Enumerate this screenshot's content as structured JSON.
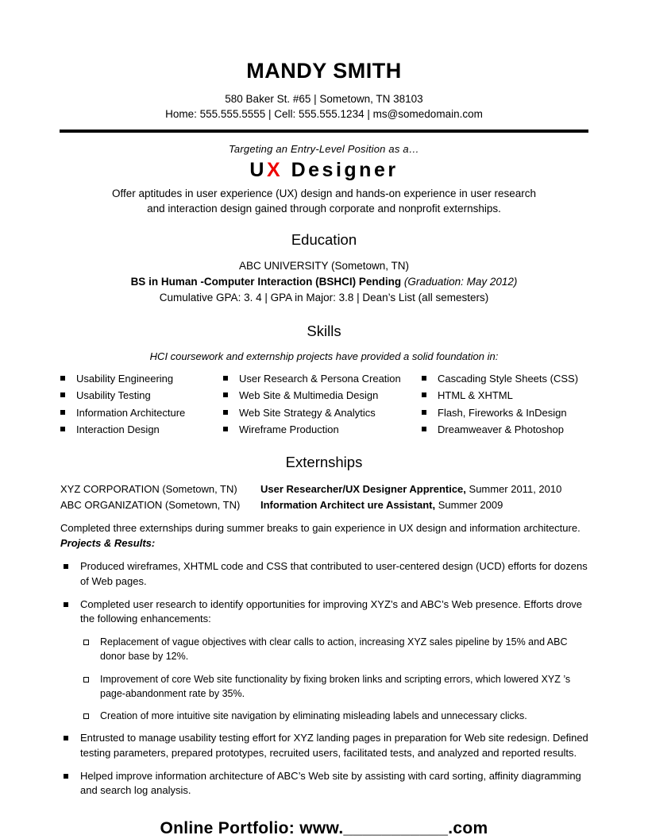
{
  "header": {
    "name": "MANDY SMITH",
    "address": "580 Baker St. #65 | Sometown, TN 38103",
    "contact": "Home:  555.555.5555 | Cell:  555.555.1234 | ms@somedomain.com"
  },
  "objective": {
    "tagline": "Targeting an Entry-Level Position as a…",
    "title_pre": "U",
    "title_accent": "X",
    "title_post": " Designer",
    "accent_color": "#ee0000",
    "summary_line1": "Offer  aptitudes in user experience (UX)  design  and hands-on experience in user research",
    "summary_line2": "and interaction design gained through  corporate and nonprofit  externships."
  },
  "sections": {
    "education_heading": "Education",
    "skills_heading": "Skills",
    "externships_heading": "Externships"
  },
  "education": {
    "school": "ABC UNIVERSITY (Sometown, TN)",
    "degree": "BS in Human -Computer Interaction  (BSHCI) Pending",
    "graduation": "(Graduation: May 2012)",
    "gpa_line": "Cumulative GPA: 3. 4 | GPA in Major: 3.8 | Dean’s List (all semesters)"
  },
  "skills": {
    "intro": "HCI coursework and externship projects  have provided a solid foundation in:",
    "column1": [
      "Usability Engineering",
      "Usability Testing",
      "Information Architecture",
      "Interaction Design"
    ],
    "column2": [
      "User Research & Persona Creation",
      "Web Site & Multimedia Design",
      "Web Site Strategy & Analytics",
      "Wireframe Production"
    ],
    "column3": [
      "Cascading Style Sheets (CSS)",
      "HTML & XHTML",
      "Flash, Fireworks & InDesign",
      "Dreamweaver & Photoshop"
    ]
  },
  "externships": {
    "jobs": [
      {
        "company": "XYZ CORPORATION (Sometown, TN)",
        "title": "User Researcher/UX Designer Apprentice,",
        "dates": " Summer 2011, 2010"
      },
      {
        "company": "ABC ORGANIZATION (Sometown, TN)",
        "title": "Information Architect ure Assistant,",
        "dates": " Summer 2009"
      }
    ],
    "intro_text": "Completed three externships during summer  breaks to gain experience in UX design and information architecture. ",
    "intro_emphasis": "Projects & Results:",
    "bullets": [
      "Produced wireframes, XHTML code and CSS that contributed to user-centered design (UCD) efforts for dozens of Web pages.",
      "Completed user research to identify  opportunities for  improving XYZ’s and ABC’s Web presence. Efforts drove the following enhancements:"
    ],
    "subbullets": [
      "Replacement of vague objectives with clear calls to action,  increasing XYZ sales pipeline by 15% and ABC donor base by 12%.",
      "Improvement of core Web site functionality by fixing broken links and scripting errors,  which lowered XYZ ’s page-abandonment rate by 35%.",
      "Creation of more intuitive site navigation by eliminating misleading labels and unnecessary  clicks."
    ],
    "bullets_after": [
      "Entrusted to manage usability testing effort for XYZ landing pages in preparation for  Web site redesign. Defined testing parameters, prepared prototypes, recruited users, facilitated tests,  and analyzed and reported results.",
      "Helped improve information architecture of ABC’s Web site by  assisting with card sorting, affinity diagramming and search log analysis."
    ]
  },
  "footer": {
    "portfolio": "Online Portfolio: www.___________.com"
  }
}
